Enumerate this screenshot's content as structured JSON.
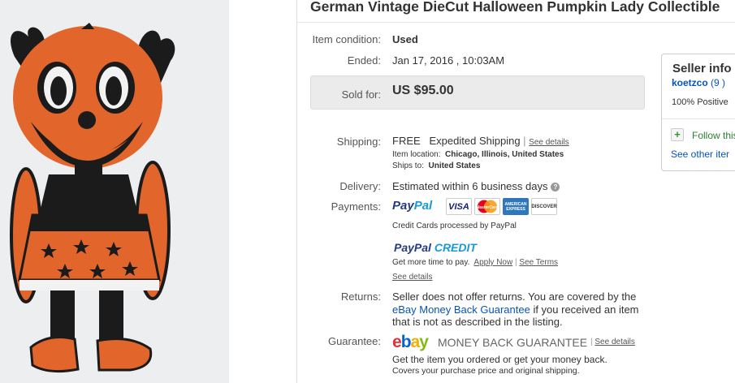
{
  "listing": {
    "title": "German Vintage DieCut Halloween Pumpkin Lady Collectible",
    "condition_label": "Item condition:",
    "condition_value": "Used",
    "ended_label": "Ended:",
    "ended_value": "Jan 17, 2016 , 10:03AM",
    "sold_label": "Sold for:",
    "sold_value": "US $95.00"
  },
  "shipping": {
    "label": "Shipping:",
    "cost": "FREE",
    "method": "Expedited Shipping",
    "see_details": "See details",
    "location_label": "Item location:",
    "location_value": "Chicago, Illinois, United States",
    "ships_label": "Ships to:",
    "ships_value": "United States"
  },
  "delivery": {
    "label": "Delivery:",
    "value": "Estimated within 6 business days"
  },
  "payments": {
    "label": "Payments:",
    "paypal_a": "Pay",
    "paypal_b": "Pal",
    "cards": [
      "VISA",
      "MasterCard",
      "AMERICAN EXPRESS",
      "DISCOVER"
    ],
    "note": "Credit Cards processed by PayPal",
    "credit_a": "PayPal",
    "credit_b": " CREDIT",
    "more_time": "Get more time to pay.",
    "apply_now": "Apply Now",
    "see_terms": "See Terms",
    "see_details": "See details"
  },
  "returns": {
    "label": "Returns:",
    "line1": "Seller does not offer returns. You are covered by the",
    "link": "eBay Money Back Guarantee",
    "line2_rest": " if you received an item",
    "line3": "that is not as described in the listing."
  },
  "guarantee": {
    "label": "Guarantee:",
    "logo": [
      "e",
      "b",
      "a",
      "y"
    ],
    "mbg": "MONEY BACK GUARANTEE",
    "see_details": "See details",
    "line1": "Get the item you ordered or get your money back.",
    "line2": "Covers your purchase price and original shipping."
  },
  "seller": {
    "title": "Seller info",
    "name": "koetzco",
    "score": "(9 )",
    "positive": "100% Positive",
    "follow": "Follow this",
    "see_other": "See other iter"
  },
  "colors": {
    "link": "#0654ba",
    "pumpkin": "#e2652c",
    "ebay_red": "#e53238",
    "ebay_blue": "#0064d2",
    "ebay_yellow": "#f5af02",
    "ebay_green": "#86b817"
  }
}
